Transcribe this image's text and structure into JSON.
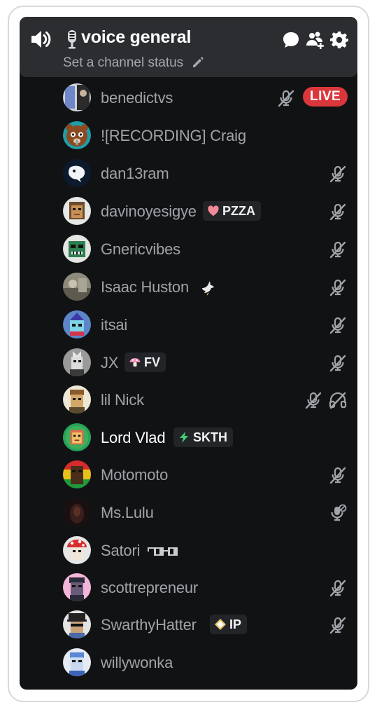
{
  "channel": {
    "name": "voice general",
    "status_placeholder": "Set a channel status"
  },
  "header_icons": [
    "speaker-icon",
    "microphone-icon",
    "chat-bubble-icon",
    "invite-people-icon",
    "gear-icon"
  ],
  "live_label": "LIVE",
  "members": [
    {
      "name": "benedictvs",
      "status": [
        "muted",
        "live"
      ]
    },
    {
      "name": "![RECORDING] Craig",
      "status": []
    },
    {
      "name": "dan13ram",
      "status": [
        "muted"
      ]
    },
    {
      "name": "davinoyesigye",
      "tag": {
        "icon": "heart",
        "text": "PZZA"
      },
      "status": [
        "muted"
      ]
    },
    {
      "name": "Gnericvibes",
      "status": [
        "muted"
      ]
    },
    {
      "name": "Isaac Huston",
      "decoration": "dove",
      "status": [
        "muted"
      ]
    },
    {
      "name": "itsai",
      "status": [
        "muted"
      ]
    },
    {
      "name": "JX",
      "tag": {
        "icon": "mushroom",
        "text": "FV"
      },
      "status": [
        "muted"
      ]
    },
    {
      "name": "lil Nick",
      "status": [
        "muted",
        "deafened"
      ]
    },
    {
      "name": "Lord Vlad",
      "tag": {
        "icon": "lightning",
        "text": "SKTH"
      },
      "status": [],
      "speaking": true
    },
    {
      "name": "Motomoto",
      "status": [
        "muted"
      ]
    },
    {
      "name": "Ms.Lulu",
      "status": [
        "server-muted"
      ]
    },
    {
      "name": "Satori",
      "decoration": "glasses",
      "status": []
    },
    {
      "name": "scottrepreneur",
      "status": [
        "muted"
      ]
    },
    {
      "name": "SwarthyHatter",
      "tag": {
        "icon": "diamond",
        "text": "IP"
      },
      "status": [
        "muted"
      ]
    },
    {
      "name": "willywonka",
      "status": []
    }
  ],
  "colors": {
    "panel_bg": "#111214",
    "header_bg": "#2b2d31",
    "username": "#a0a3a8",
    "active_username": "#ffffff",
    "live_red": "#da373c",
    "speaking_green": "#23a55a"
  }
}
